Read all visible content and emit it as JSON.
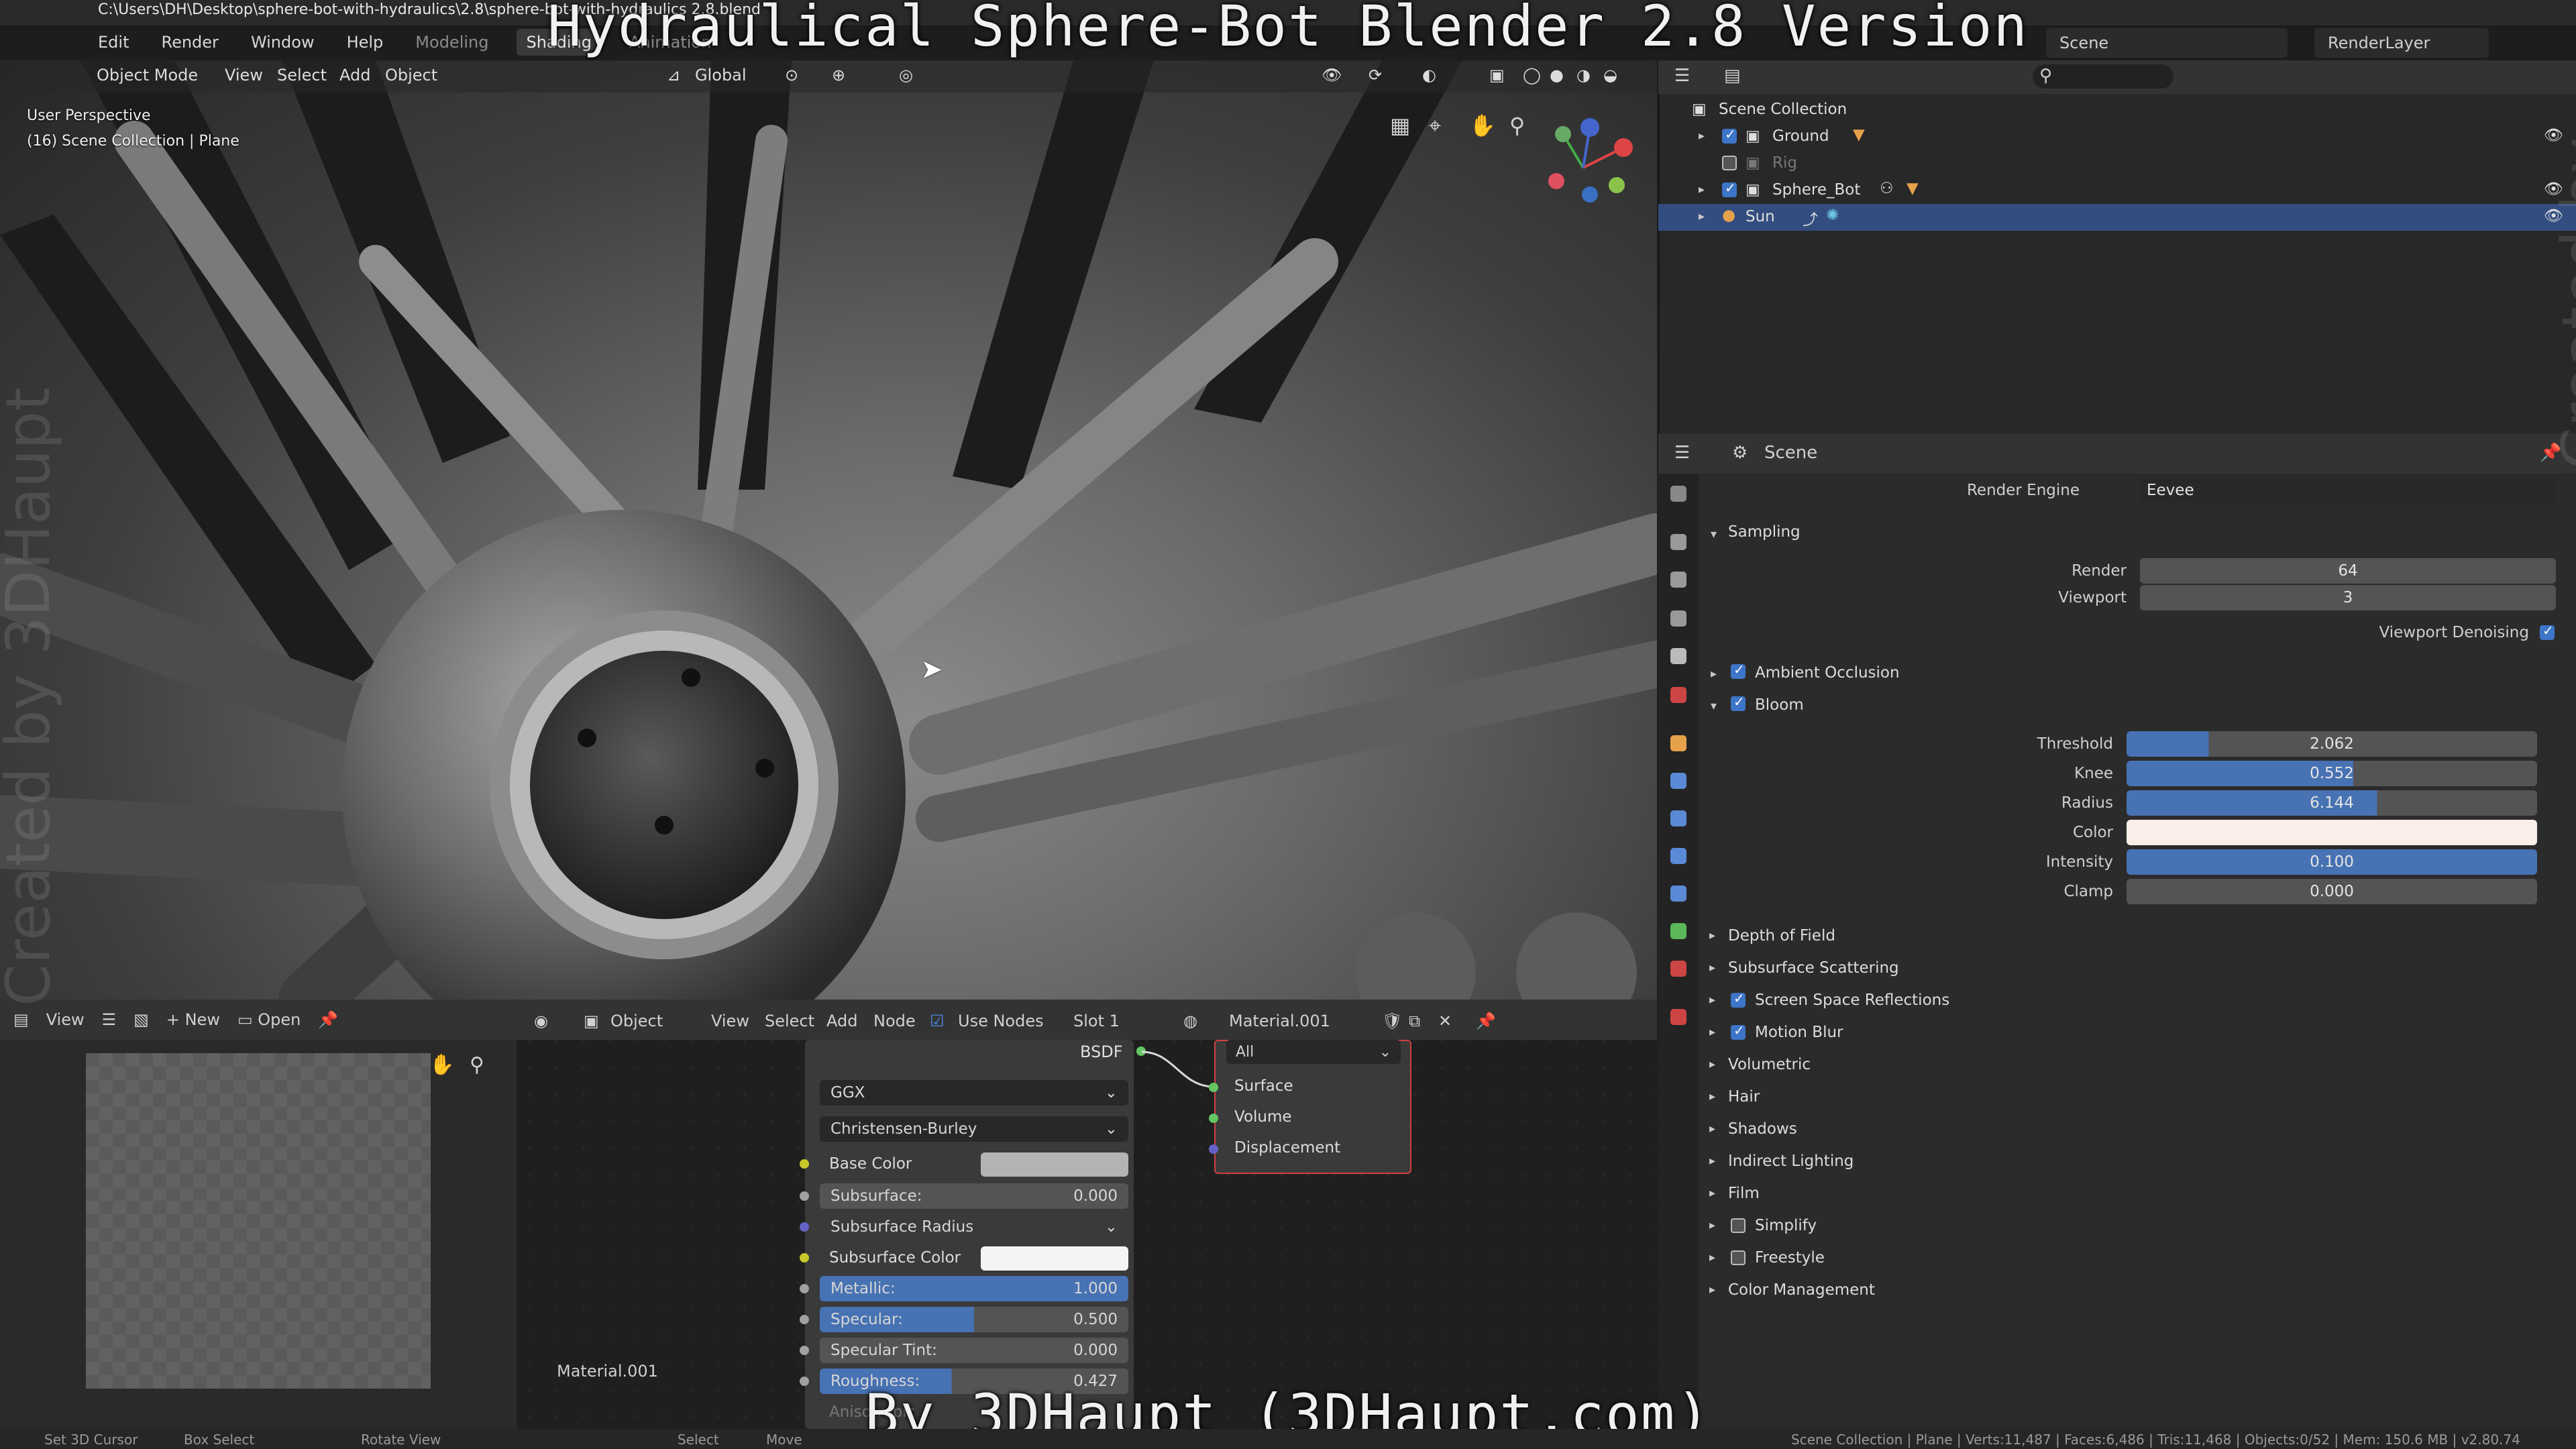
{
  "window": {
    "file_path": "C:\\Users\\DH\\Desktop\\sphere-bot-with-hydraulics\\2.8\\sphere-bot-with-hydraulics 2.8.blend",
    "video_title": "Hydraulical Sphere-Bot Blender 2.8 Version",
    "credit": "By 3DHaupt (3DHaupt.com)",
    "watermark": "Created by 3DHaupt"
  },
  "menubar": {
    "items": [
      "Edit",
      "Render",
      "Window",
      "Help"
    ],
    "workspaces": [
      "Modeling",
      "Shading",
      "Animation"
    ],
    "active_workspace": "Shading",
    "scene": "Scene",
    "render_layer": "RenderLayer"
  },
  "viewport": {
    "mode": "Object Mode",
    "menus": [
      "View",
      "Select",
      "Add",
      "Object"
    ],
    "orientation": "Global",
    "info_line1": "User Perspective",
    "info_line2": "(16) Scene Collection | Plane"
  },
  "image_editor": {
    "view": "View",
    "new_label": "New",
    "open_label": "Open"
  },
  "node_editor": {
    "object_label": "Object",
    "menus": [
      "View",
      "Select",
      "Add",
      "Node"
    ],
    "use_nodes_label": "Use Nodes",
    "slot": "Slot 1",
    "material": "Material.001",
    "bsdf_label": "BSDF",
    "distribution": "GGX",
    "subsurface_method": "Christensen-Burley",
    "base_color_label": "Base Color",
    "subsurface_label": "Subsurface:",
    "subsurface_value": "0.000",
    "subsurface_radius_label": "Subsurface Radius",
    "subsurface_color_label": "Subsurface Color",
    "metallic_label": "Metallic:",
    "metallic_value": "1.000",
    "specular_label": "Specular:",
    "specular_value": "0.500",
    "specular_tint_label": "Specular Tint:",
    "specular_tint_value": "0.000",
    "roughness_label": "Roughness:",
    "roughness_value": "0.427",
    "anisotropic_label": "Anisotropic",
    "output_target": "All",
    "output_sockets": [
      "Surface",
      "Volume",
      "Displacement"
    ],
    "frame_label": "Material.001"
  },
  "outliner": {
    "root": "Scene Collection",
    "items": [
      {
        "name": "Ground",
        "checked": true
      },
      {
        "name": "Rig",
        "checked": false
      },
      {
        "name": "Sphere_Bot",
        "checked": true
      },
      {
        "name": "Sun",
        "checked": null
      }
    ]
  },
  "properties": {
    "context": "Scene",
    "render_engine_label": "Render Engine",
    "render_engine": "Eevee",
    "sampling_label": "Sampling",
    "render_label": "Render",
    "render_samples": "64",
    "viewport_label": "Viewport",
    "viewport_samples": "3",
    "viewport_denoising_label": "Viewport Denoising",
    "ambient_occlusion_label": "Ambient Occlusion",
    "bloom_label": "Bloom",
    "bloom": {
      "threshold_label": "Threshold",
      "threshold": "2.062",
      "threshold_fill": 0.2,
      "knee_label": "Knee",
      "knee": "0.552",
      "knee_fill": 0.552,
      "radius_label": "Radius",
      "radius": "6.144",
      "radius_fill": 0.61,
      "color_label": "Color",
      "intensity_label": "Intensity",
      "intensity": "0.100",
      "intensity_fill": 1.0,
      "clamp_label": "Clamp",
      "clamp": "0.000"
    },
    "panels": [
      {
        "label": "Depth of Field",
        "checkbox": null
      },
      {
        "label": "Subsurface Scattering",
        "checkbox": null
      },
      {
        "label": "Screen Space Reflections",
        "checkbox": true
      },
      {
        "label": "Motion Blur",
        "checkbox": true
      },
      {
        "label": "Volumetric",
        "checkbox": null
      },
      {
        "label": "Hair",
        "checkbox": null
      },
      {
        "label": "Shadows",
        "checkbox": null
      },
      {
        "label": "Indirect Lighting",
        "checkbox": null
      },
      {
        "label": "Film",
        "checkbox": null
      },
      {
        "label": "Simplify",
        "checkbox": false
      },
      {
        "label": "Freestyle",
        "checkbox": false
      },
      {
        "label": "Color Management",
        "checkbox": null
      }
    ]
  },
  "statusbar": {
    "left": [
      "Set 3D Cursor",
      "Box Select",
      "Rotate View",
      "Select",
      "Move"
    ],
    "right": "Scene Collection | Plane | Verts:11,487 | Faces:6,486 | Tris:11,468 | Objects:0/52 | Mem: 150.6 MB | v2.80.74"
  },
  "colors": {
    "accent": "#4772b3",
    "selected_row": "#334d80",
    "bsdf_socket_green": "#63c763",
    "socket_yellow": "#c7c729",
    "socket_purple": "#6363c7",
    "output_border": "#d04040"
  }
}
